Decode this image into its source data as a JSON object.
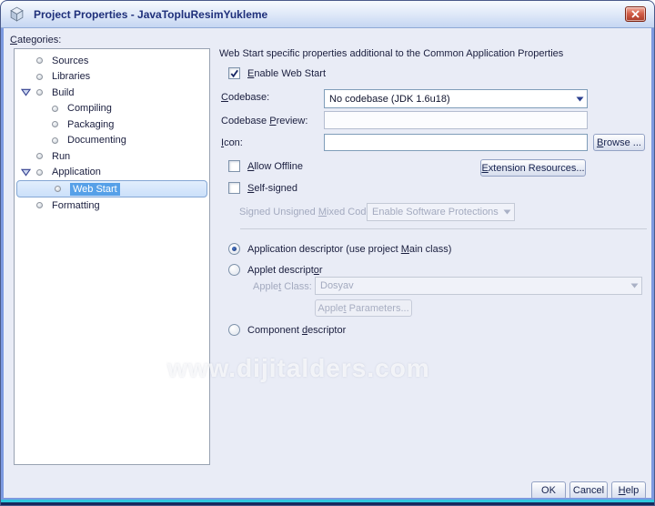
{
  "window": {
    "title": "Project Properties - JavaTopluResimYukleme"
  },
  "icons": {
    "titlebar": "cube-icon",
    "close": "close-icon",
    "tree_expander": "chevron-down-icon",
    "tree_bullet": "dot-icon",
    "combo_arrow": "chevron-down-icon",
    "checkbox_check": "check-icon",
    "radio_dot": "dot-icon"
  },
  "colors": {
    "dialog_bg": "#e9ecf6",
    "frame_blue": "#7d9ae0",
    "accent_teal_line": "#2ec8dd",
    "titlebar_text": "#1e2f7a",
    "selection_fill": "#56a0e8",
    "selection_row_border": "#84a7d4",
    "close_button_red": "#c4503c",
    "disabled_text": "#a3aabf"
  },
  "categories": {
    "label": {
      "pre": "",
      "mn": "C",
      "post": "ategories:"
    },
    "tree": [
      {
        "label": "Sources",
        "level": 1,
        "expanded": false,
        "selected": false
      },
      {
        "label": "Libraries",
        "level": 1,
        "expanded": false,
        "selected": false
      },
      {
        "label": "Build",
        "level": 1,
        "expanded": true,
        "selected": false
      },
      {
        "label": "Compiling",
        "level": 2,
        "expanded": false,
        "selected": false
      },
      {
        "label": "Packaging",
        "level": 2,
        "expanded": false,
        "selected": false
      },
      {
        "label": "Documenting",
        "level": 2,
        "expanded": false,
        "selected": false
      },
      {
        "label": "Run",
        "level": 1,
        "expanded": false,
        "selected": false
      },
      {
        "label": "Application",
        "level": 1,
        "expanded": true,
        "selected": false
      },
      {
        "label": "Web Start",
        "level": 2,
        "expanded": false,
        "selected": true
      },
      {
        "label": "Formatting",
        "level": 1,
        "expanded": false,
        "selected": false
      }
    ]
  },
  "panel": {
    "header": "Web Start specific properties additional to the Common Application Properties",
    "enable_web_start": {
      "label": {
        "pre": "",
        "mn": "E",
        "post": "nable Web Start"
      },
      "checked": true
    },
    "codebase": {
      "label": {
        "pre": "",
        "mn": "C",
        "post": "odebase:"
      },
      "value": "No codebase (JDK 1.6u18)"
    },
    "codebase_preview": {
      "label": {
        "pre": "Codebase ",
        "mn": "P",
        "post": "review:"
      },
      "value": ""
    },
    "icon": {
      "label": {
        "pre": "",
        "mn": "I",
        "post": "con:"
      },
      "value": ""
    },
    "browse_button": {
      "pre": "",
      "mn": "B",
      "post": "rowse ..."
    },
    "allow_offline": {
      "label": {
        "pre": "",
        "mn": "A",
        "post": "llow Offline"
      },
      "checked": false
    },
    "extension_resources_button": {
      "pre": "",
      "mn": "E",
      "post": "xtension Resources..."
    },
    "self_signed": {
      "label": {
        "pre": "",
        "mn": "S",
        "post": "elf-signed"
      },
      "checked": false
    },
    "mixed_code": {
      "label": {
        "pre": "Signed Unsigned ",
        "mn": "M",
        "post": "ixed Code:"
      },
      "value": "Enable Software Protections",
      "disabled": true
    },
    "descriptors": {
      "application": {
        "label": {
          "pre": "Application descriptor (use project ",
          "mn": "M",
          "post": "ain class)"
        },
        "selected": true
      },
      "applet": {
        "label": {
          "pre": "Applet descript",
          "mn": "o",
          "post": "r"
        },
        "selected": false
      },
      "applet_class": {
        "label": {
          "pre": "Apple",
          "mn": "t",
          "post": " Class:"
        },
        "value": "Dosyav",
        "disabled": true
      },
      "applet_parameters_button": {
        "pre": "Apple",
        "mn": "t",
        "post": " Parameters..."
      },
      "component": {
        "label": {
          "pre": "Component ",
          "mn": "d",
          "post": "escriptor"
        },
        "selected": false
      }
    }
  },
  "watermark": "www.dijitalders.com",
  "footer": {
    "ok": "OK",
    "cancel": "Cancel",
    "help": {
      "pre": "",
      "mn": "H",
      "post": "elp"
    }
  }
}
